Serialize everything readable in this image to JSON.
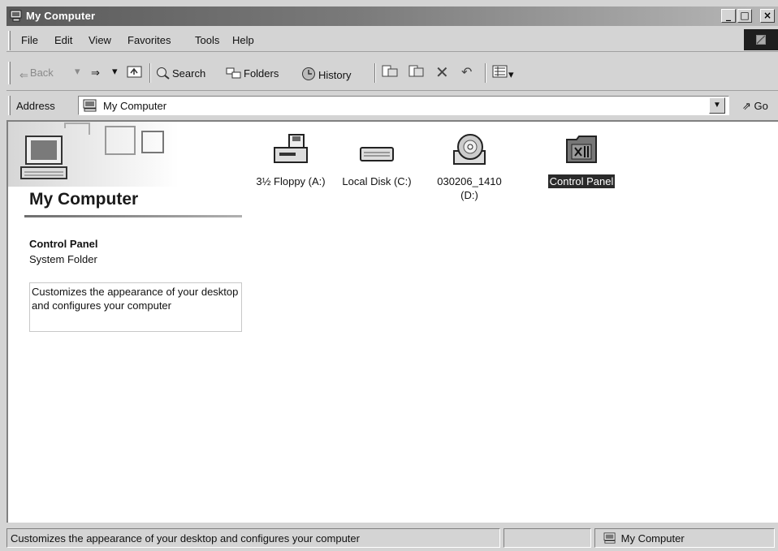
{
  "window": {
    "title": "My Computer",
    "minimize": "_",
    "maximize": "□",
    "close": "×"
  },
  "menu": [
    "File",
    "Edit",
    "View",
    "Favorites",
    "Tools",
    "Help"
  ],
  "toolbar": {
    "back": "Back",
    "search": "Search",
    "folders": "Folders",
    "history": "History"
  },
  "address": {
    "label": "Address",
    "value": "My Computer",
    "go": "Go"
  },
  "left_panel": {
    "title": "My Computer",
    "item_title": "Control Panel",
    "item_type": "System Folder",
    "item_desc": "Customizes the appearance of your desktop and configures your computer"
  },
  "files": [
    {
      "name": "3½ Floppy (A:)",
      "icon": "floppy-drive-icon"
    },
    {
      "name": "Local Disk (C:)",
      "icon": "hard-disk-icon"
    },
    {
      "name": "030206_1410 (D:)",
      "icon": "cd-drive-icon"
    },
    {
      "name": "Control Panel",
      "icon": "control-panel-icon",
      "selected": true
    }
  ],
  "status": {
    "text": "Customizes the appearance of your desktop and configures your computer",
    "zone": "My Computer"
  }
}
